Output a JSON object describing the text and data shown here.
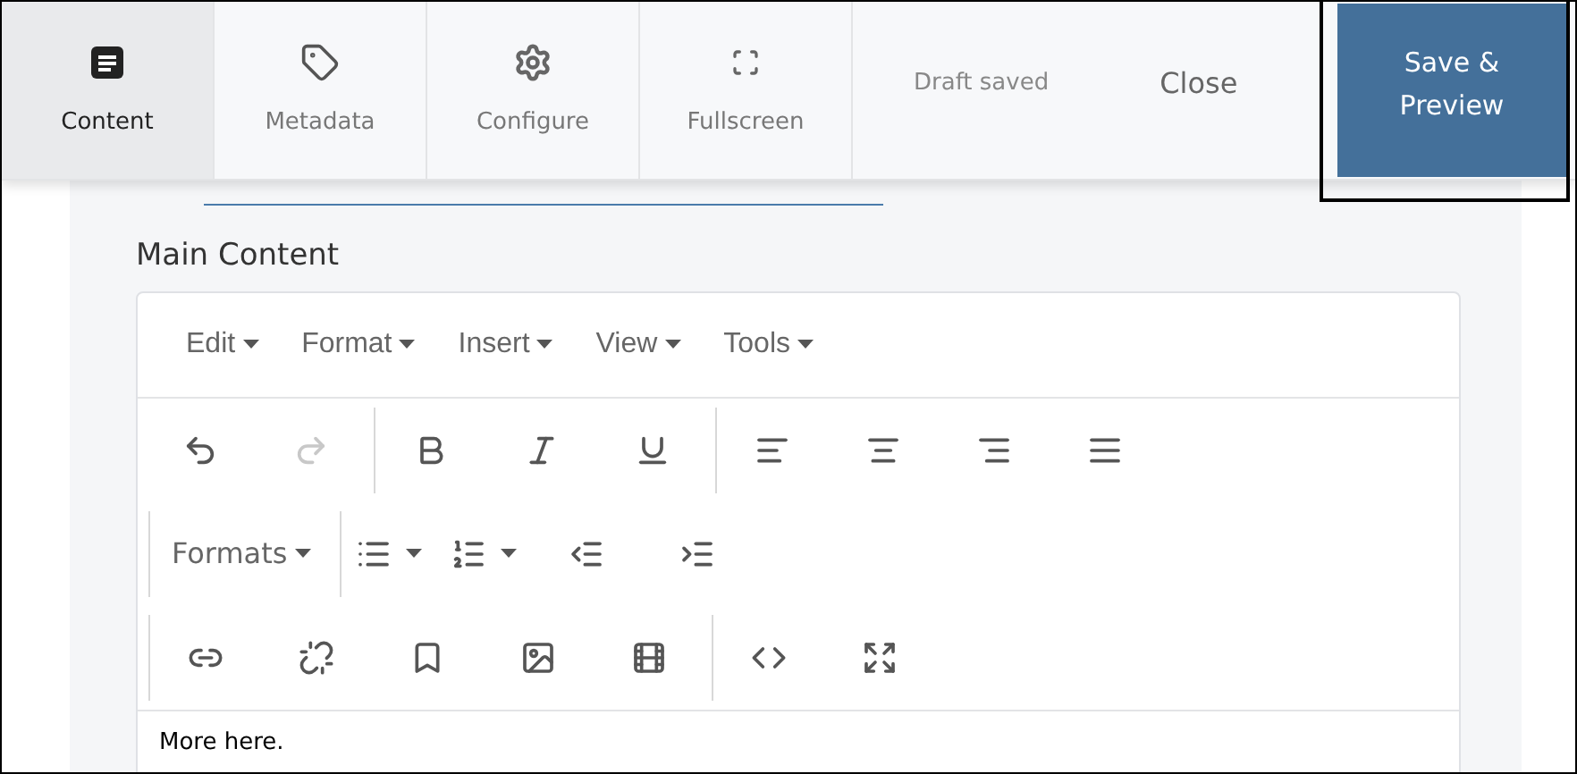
{
  "tabs": [
    {
      "label": "Content",
      "selected": true
    },
    {
      "label": "Metadata",
      "selected": false
    },
    {
      "label": "Configure",
      "selected": false
    },
    {
      "label": "Fullscreen",
      "selected": false
    }
  ],
  "status": "Draft saved",
  "close_button": "Close",
  "save_button": "Save & Preview",
  "field": {
    "label": "Main Content"
  },
  "menubar": [
    "Edit",
    "Format",
    "Insert",
    "View",
    "Tools"
  ],
  "toolbar_rows": [
    [
      [
        {
          "kind": "icon",
          "disabled": false
        },
        {
          "kind": "icon",
          "disabled": true
        }
      ],
      [
        {
          "kind": "icon",
          "disabled": false
        },
        {
          "kind": "icon",
          "disabled": false
        },
        {
          "kind": "icon",
          "disabled": false
        }
      ],
      [
        {
          "kind": "icon",
          "disabled": false
        },
        {
          "kind": "icon",
          "disabled": false
        },
        {
          "kind": "icon",
          "disabled": false
        },
        {
          "kind": "icon",
          "disabled": false
        }
      ]
    ],
    [
      [
        {
          "kind": "dropdown",
          "label": "Formats"
        }
      ],
      [
        {
          "kind": "split",
          "disabled": false
        },
        {
          "kind": "split",
          "disabled": false
        },
        {
          "kind": "icon",
          "disabled": false
        },
        {
          "kind": "icon",
          "disabled": false
        }
      ]
    ],
    [
      [
        {
          "kind": "icon",
          "disabled": false
        },
        {
          "kind": "icon",
          "disabled": false
        },
        {
          "kind": "icon",
          "disabled": false
        },
        {
          "kind": "icon",
          "disabled": false
        },
        {
          "kind": "icon",
          "disabled": false
        }
      ],
      [
        {
          "kind": "icon",
          "disabled": false
        },
        {
          "kind": "icon",
          "disabled": false
        }
      ]
    ]
  ],
  "body_text": "More here."
}
